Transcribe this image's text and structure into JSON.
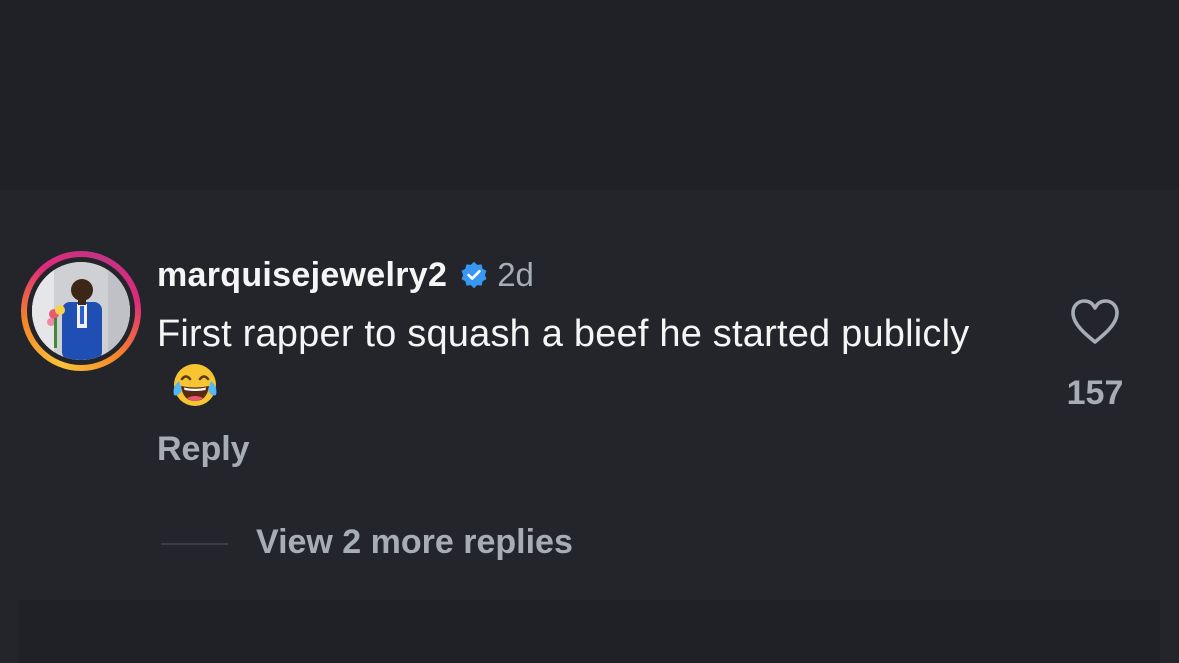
{
  "comment": {
    "username": "marquisejewelry2",
    "verified": true,
    "timestamp": "2d",
    "text": "First rapper to squash a beef he started publicly",
    "emoji": "face-with-tears-of-joy",
    "reply_label": "Reply",
    "like_count": "157",
    "view_replies_label": "View 2 more replies"
  },
  "colors": {
    "background": "#23252b",
    "primary_text": "#f5f5f5",
    "secondary_text": "#a8acb3",
    "verified_blue": "#3897f0"
  },
  "icons": {
    "verified": "verified-badge-icon",
    "like": "heart-outline-icon",
    "avatar": "profile-picture"
  }
}
